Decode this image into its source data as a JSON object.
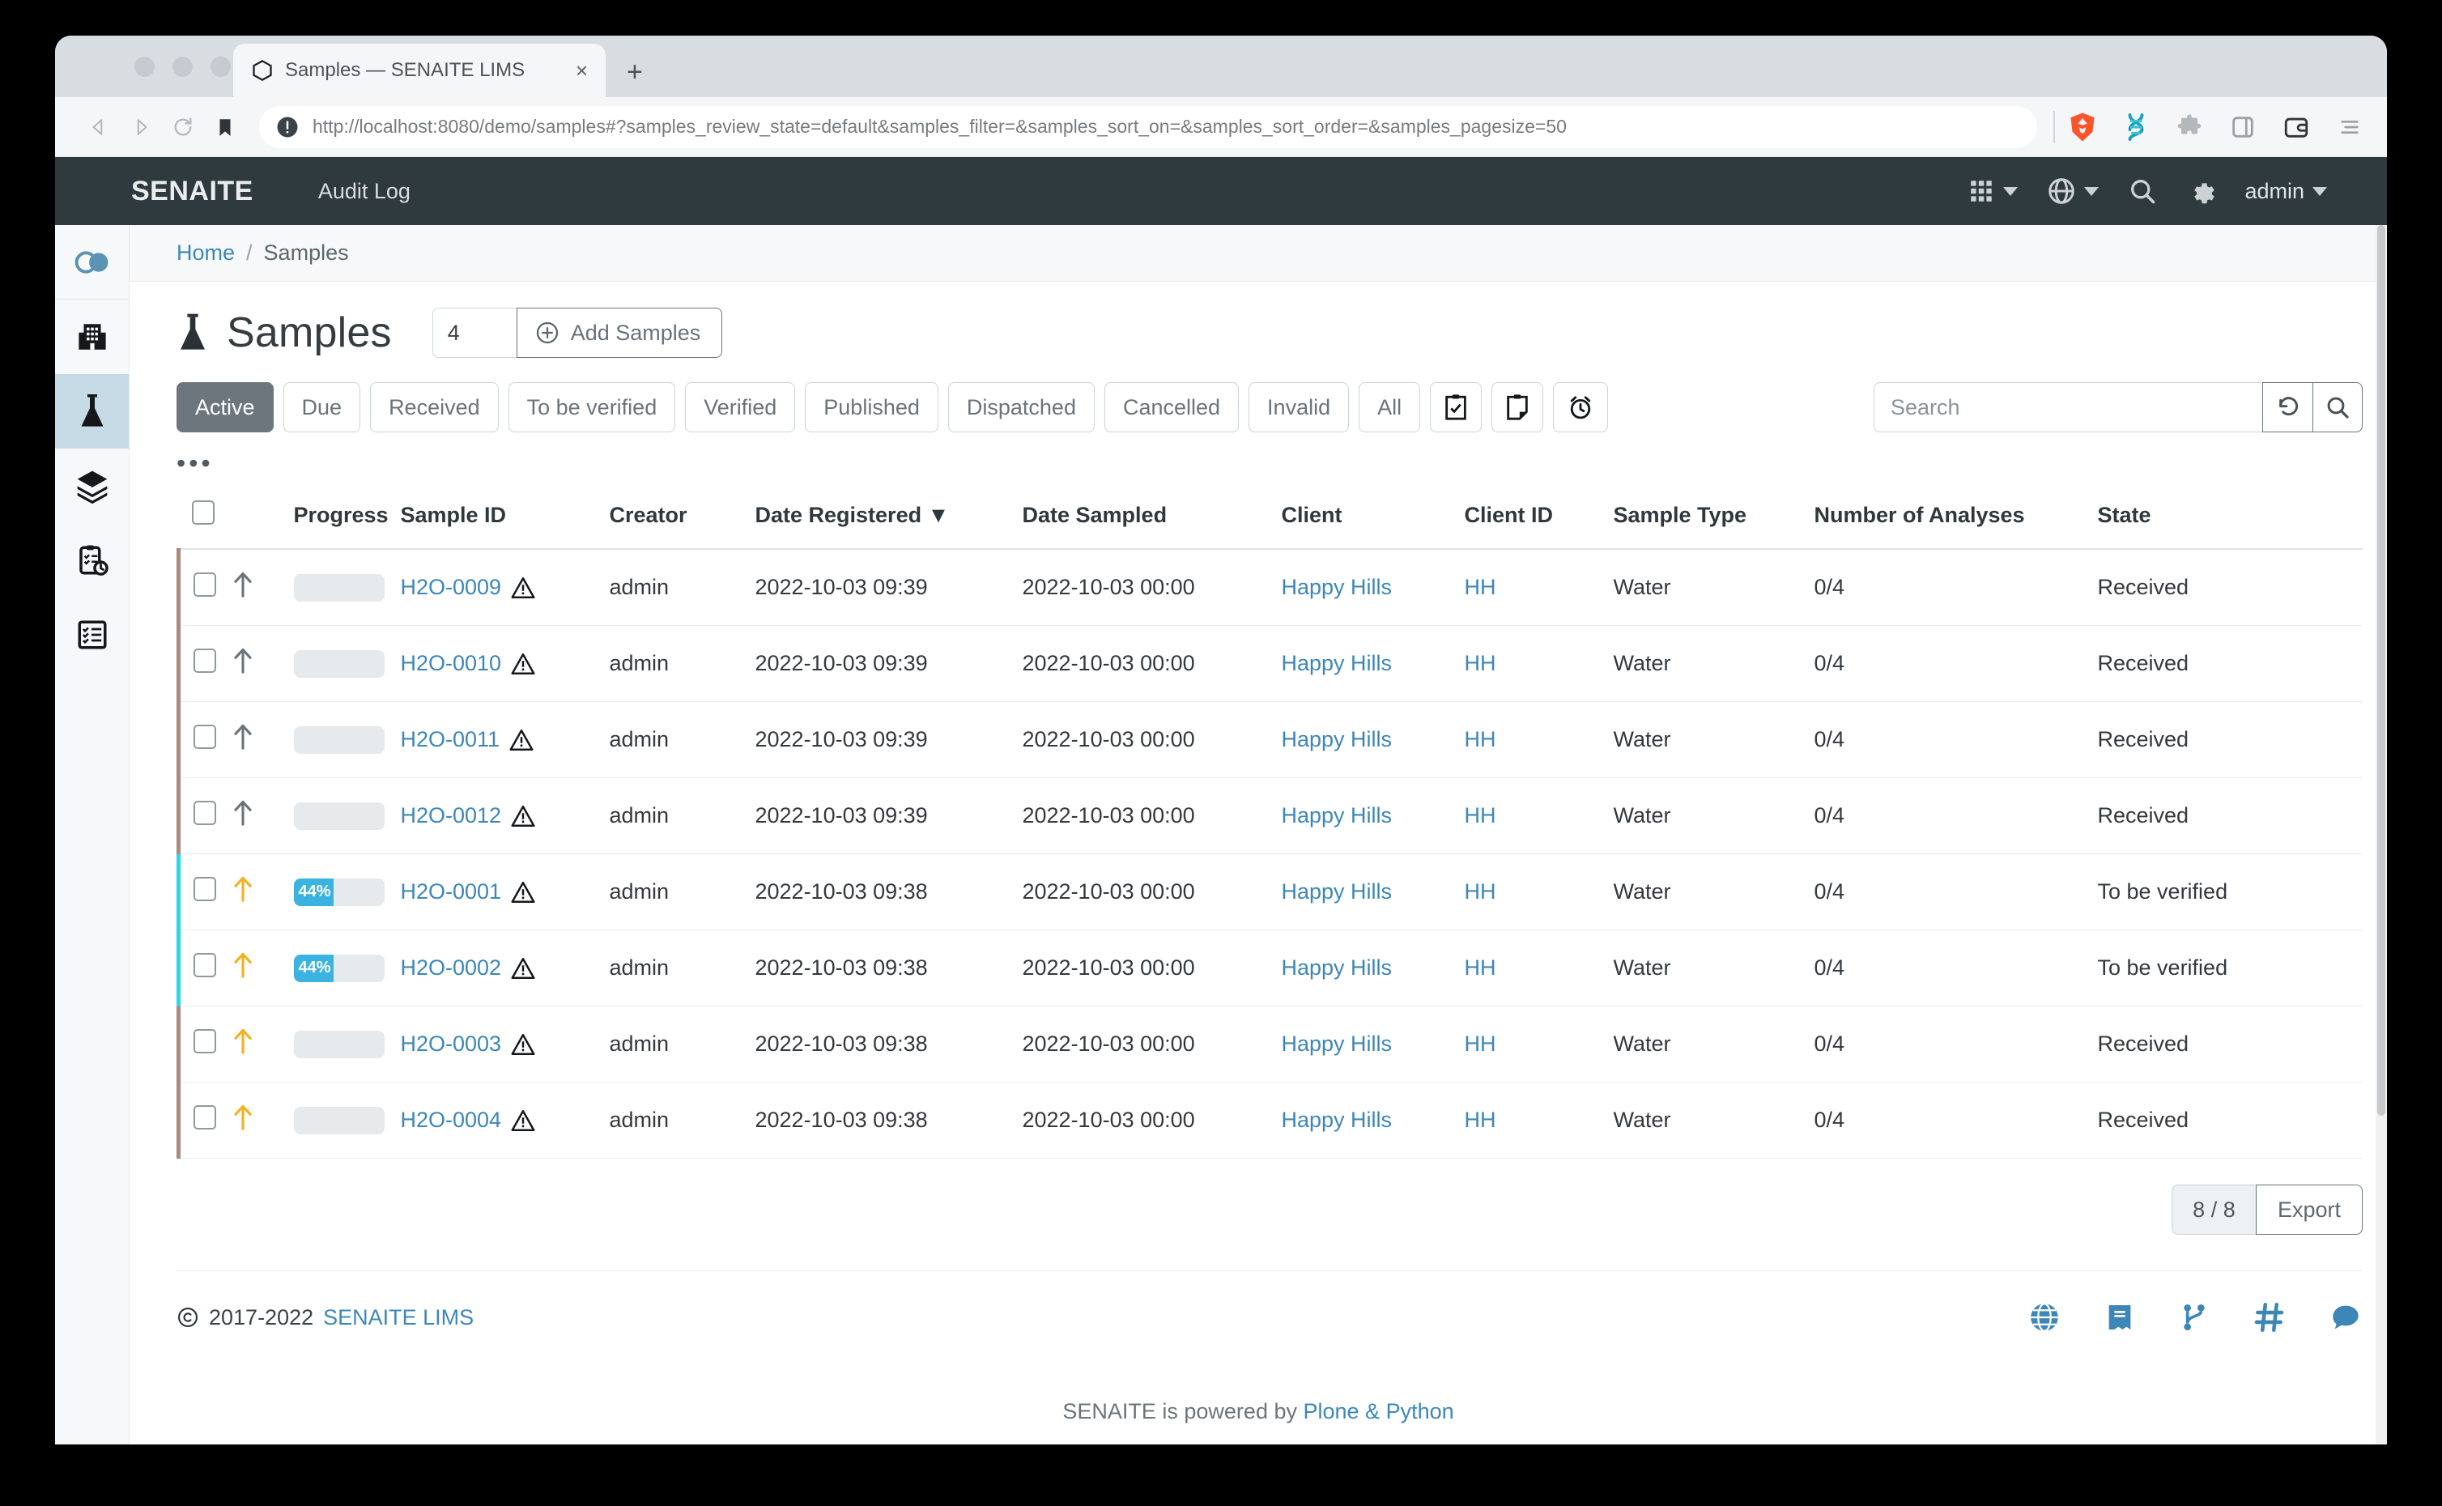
{
  "browser": {
    "tab_title": "Samples — SENAITE LIMS",
    "tab_close": "×",
    "new_tab": "+",
    "url": "http://localhost:8080/demo/samples#?samples_review_state=default&samples_filter=&samples_sort_on=&samples_sort_order=&samples_pagesize=50",
    "url_host": "localhost:8080",
    "icons": [
      "back-icon",
      "forward-icon",
      "reload-icon",
      "bookmark-icon",
      "brave-shield-icon",
      "extension-dna-icon",
      "extension-puzzle-icon",
      "sidebar-icon",
      "wallet-icon",
      "menu-icon"
    ]
  },
  "topbar": {
    "brand": "SENAITE",
    "audit_log": "Audit Log",
    "user": "admin",
    "icons": [
      "apps-grid-icon",
      "globe-icon",
      "search-icon",
      "gear-icon"
    ]
  },
  "sidebar": {
    "items": [
      {
        "name": "toggle-sidebar",
        "icon": "toggle-pill-icon",
        "active": false
      },
      {
        "name": "clients",
        "icon": "building-icon",
        "active": false
      },
      {
        "name": "samples",
        "icon": "flask-icon",
        "active": true
      },
      {
        "name": "batches",
        "icon": "layers-icon",
        "active": false
      },
      {
        "name": "worksheets",
        "icon": "clipboard-clock-icon",
        "active": false
      },
      {
        "name": "tasks",
        "icon": "checklist-icon",
        "active": false
      }
    ]
  },
  "breadcrumb": {
    "home": "Home",
    "separator": "/",
    "current": "Samples"
  },
  "page": {
    "title": "Samples",
    "sample_count_value": "4",
    "add_samples_label": "Add Samples",
    "more_menu": "•••"
  },
  "filters": {
    "tabs": [
      {
        "label": "Active",
        "active": true
      },
      {
        "label": "Due",
        "active": false
      },
      {
        "label": "Received",
        "active": false
      },
      {
        "label": "To be verified",
        "active": false
      },
      {
        "label": "Verified",
        "active": false
      },
      {
        "label": "Published",
        "active": false
      },
      {
        "label": "Dispatched",
        "active": false
      },
      {
        "label": "Cancelled",
        "active": false
      },
      {
        "label": "Invalid",
        "active": false
      },
      {
        "label": "All",
        "active": false
      }
    ],
    "icon_buttons": [
      "clipboard-check-icon",
      "clipboard-partial-icon",
      "alarm-clock-icon"
    ]
  },
  "search": {
    "value": "",
    "placeholder": "Search",
    "reset_icon": "reset-arrow-icon",
    "submit_icon": "search-icon"
  },
  "table": {
    "columns": [
      "",
      "",
      "Progress",
      "Sample ID",
      "Creator",
      "Date Registered",
      "Date Sampled",
      "Client",
      "Client ID",
      "Sample Type",
      "Number of Analyses",
      "State"
    ],
    "sorted_column": "Date Registered",
    "sort_indicator": "▼",
    "rows": [
      {
        "progress": 0,
        "progress_label": "",
        "sample_id": "H2O-0009",
        "creator": "admin",
        "date_registered": "2022-10-03 09:39",
        "date_sampled": "2022-10-03 00:00",
        "client": "Happy Hills",
        "client_id": "HH",
        "sample_type": "Water",
        "number_of_analyses": "0/4",
        "state": "Received",
        "state_class": "st-received",
        "priority_icon": "arrow-up-icon",
        "priority_color": "#6b747a",
        "warning": true
      },
      {
        "progress": 0,
        "progress_label": "",
        "sample_id": "H2O-0010",
        "creator": "admin",
        "date_registered": "2022-10-03 09:39",
        "date_sampled": "2022-10-03 00:00",
        "client": "Happy Hills",
        "client_id": "HH",
        "sample_type": "Water",
        "number_of_analyses": "0/4",
        "state": "Received",
        "state_class": "st-received",
        "priority_icon": "arrow-up-icon",
        "priority_color": "#6b747a",
        "warning": true
      },
      {
        "progress": 0,
        "progress_label": "",
        "sample_id": "H2O-0011",
        "creator": "admin",
        "date_registered": "2022-10-03 09:39",
        "date_sampled": "2022-10-03 00:00",
        "client": "Happy Hills",
        "client_id": "HH",
        "sample_type": "Water",
        "number_of_analyses": "0/4",
        "state": "Received",
        "state_class": "st-received",
        "priority_icon": "arrow-up-icon",
        "priority_color": "#6b747a",
        "warning": true
      },
      {
        "progress": 0,
        "progress_label": "",
        "sample_id": "H2O-0012",
        "creator": "admin",
        "date_registered": "2022-10-03 09:39",
        "date_sampled": "2022-10-03 00:00",
        "client": "Happy Hills",
        "client_id": "HH",
        "sample_type": "Water",
        "number_of_analyses": "0/4",
        "state": "Received",
        "state_class": "st-received",
        "priority_icon": "arrow-up-icon",
        "priority_color": "#6b747a",
        "warning": true
      },
      {
        "progress": 44,
        "progress_label": "44%",
        "sample_id": "H2O-0001",
        "creator": "admin",
        "date_registered": "2022-10-03 09:38",
        "date_sampled": "2022-10-03 00:00",
        "client": "Happy Hills",
        "client_id": "HH",
        "sample_type": "Water",
        "number_of_analyses": "0/4",
        "state": "To be verified",
        "state_class": "st-tobeverified",
        "priority_icon": "arrow-up-icon",
        "priority_color": "#f4b01f",
        "warning": true
      },
      {
        "progress": 44,
        "progress_label": "44%",
        "sample_id": "H2O-0002",
        "creator": "admin",
        "date_registered": "2022-10-03 09:38",
        "date_sampled": "2022-10-03 00:00",
        "client": "Happy Hills",
        "client_id": "HH",
        "sample_type": "Water",
        "number_of_analyses": "0/4",
        "state": "To be verified",
        "state_class": "st-tobeverified",
        "priority_icon": "arrow-up-icon",
        "priority_color": "#f4b01f",
        "warning": true
      },
      {
        "progress": 0,
        "progress_label": "",
        "sample_id": "H2O-0003",
        "creator": "admin",
        "date_registered": "2022-10-03 09:38",
        "date_sampled": "2022-10-03 00:00",
        "client": "Happy Hills",
        "client_id": "HH",
        "sample_type": "Water",
        "number_of_analyses": "0/4",
        "state": "Received",
        "state_class": "st-received",
        "priority_icon": "arrow-up-icon",
        "priority_color": "#f4b01f",
        "warning": true
      },
      {
        "progress": 0,
        "progress_label": "",
        "sample_id": "H2O-0004",
        "creator": "admin",
        "date_registered": "2022-10-03 09:38",
        "date_sampled": "2022-10-03 00:00",
        "client": "Happy Hills",
        "client_id": "HH",
        "sample_type": "Water",
        "number_of_analyses": "0/4",
        "state": "Received",
        "state_class": "st-received",
        "priority_icon": "arrow-up-icon",
        "priority_color": "#f4b01f",
        "warning": true
      }
    ]
  },
  "table_footer": {
    "count": "8 / 8",
    "export_label": "Export"
  },
  "footer": {
    "copyright_symbol": "©",
    "copyright_years": "2017-2022",
    "copyright_link": "SENAITE LIMS",
    "powered_prefix": "SENAITE is powered by",
    "powered_link": "Plone & Python",
    "icons": [
      "globe-icon",
      "book-icon",
      "git-branch-icon",
      "hash-icon",
      "chat-icon"
    ]
  },
  "colors": {
    "topbar_bg": "#2e3a3e",
    "link": "#3d87b8",
    "active_filter_bg": "#6d767c",
    "progress_fill": "#3bb3e0",
    "priority_high": "#f4b01f",
    "row_received_border": "#a98a7c",
    "row_tobeverified_border": "#2ad6e8",
    "sidebar_active_bg": "#c6dbe5"
  }
}
